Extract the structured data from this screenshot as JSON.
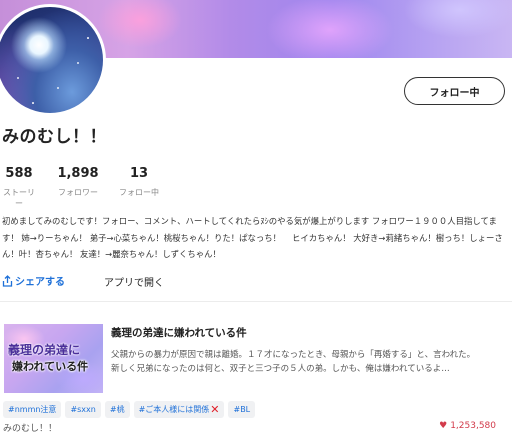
{
  "profile": {
    "username": "みのむし！！",
    "follow_button": "フォロー中",
    "stats": [
      {
        "value": "588",
        "label": "ストーリー"
      },
      {
        "value": "1,898",
        "label": "フォロワー"
      },
      {
        "value": "13",
        "label": "フォロー中"
      }
    ],
    "bio": "初めましてみのむしです！フォロー、コメント、ハートしてくれたらﾇｼのやる気が爆上がりします フォロワー１９００人目指してます！ 姉→りーちゃん！ 弟子→心菜ちゃん！桃桜ちゃん！りた！ぱなっち！　 ヒイカちゃん！ 大好き→莉緒ちゃん！樹っち！しょーさん！叶！杏ちゃん！ 友達！→麗奈ちゃん！しずくちゃん！"
  },
  "actions": {
    "share_label": "シェアする",
    "open_app_label": "アプリで開く"
  },
  "story": {
    "title": "義理の弟達に嫌われている件",
    "thumb_line1": "義理の弟達に",
    "thumb_line2": "嫌われている件",
    "desc_line1": "父親からの暴力が原因で親は離婚。１７才になったとき、母親から「再婚する」と、言われた。",
    "desc_line2": "新しく兄弟になったのは何と、双子と三つ子の５人の弟。しかも、俺は嫌われているよ…",
    "tags": [
      "#nmmn注意",
      "#sxxn",
      "#桃",
      "#ご本人様には関係",
      "#BL"
    ],
    "author": "みのむし！！",
    "likes": "1,253,580"
  },
  "colors": {
    "accent_blue": "#1e70d8",
    "like_red": "#d23b4b"
  }
}
